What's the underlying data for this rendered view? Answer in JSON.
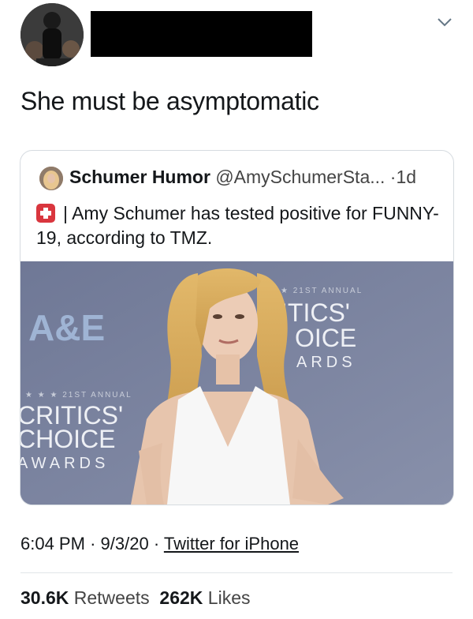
{
  "tweet": {
    "text": "She must be asymptomatic",
    "time": "6:04 PM",
    "date": "9/3/20",
    "source": "Twitter for iPhone",
    "separator": "·"
  },
  "quote": {
    "name": "Schumer Humor",
    "handle": "@AmySchumerSta...",
    "age": "1d",
    "dot": "·",
    "text": "| Amy Schumer  has tested positive for FUNNY-19, according to TMZ.",
    "photo": {
      "backdrop_brand": "A&E",
      "backdrop_top_small": "★ 21ST ANNUAL",
      "backdrop_top_lines": [
        "ITICS'",
        "OICE",
        "ARDS"
      ],
      "backdrop_bottom_small": "★ ★ ★ 21ST ANNUAL",
      "backdrop_bottom_lines": [
        "CRITICS'",
        "CHOICE",
        "AWARDS"
      ]
    }
  },
  "stats": {
    "retweets_count": "30.6K",
    "retweets_label": "Retweets",
    "likes_count": "262K",
    "likes_label": "Likes"
  },
  "colors": {
    "text": "#14171a",
    "muted": "#444444",
    "border": "#d6dbe0",
    "photo_backdrop": "#7a84a0",
    "redaction": "#000000"
  },
  "icons": {
    "menu": "chevron-down-icon",
    "quote_emoji": "red-cross-emoji-icon"
  }
}
